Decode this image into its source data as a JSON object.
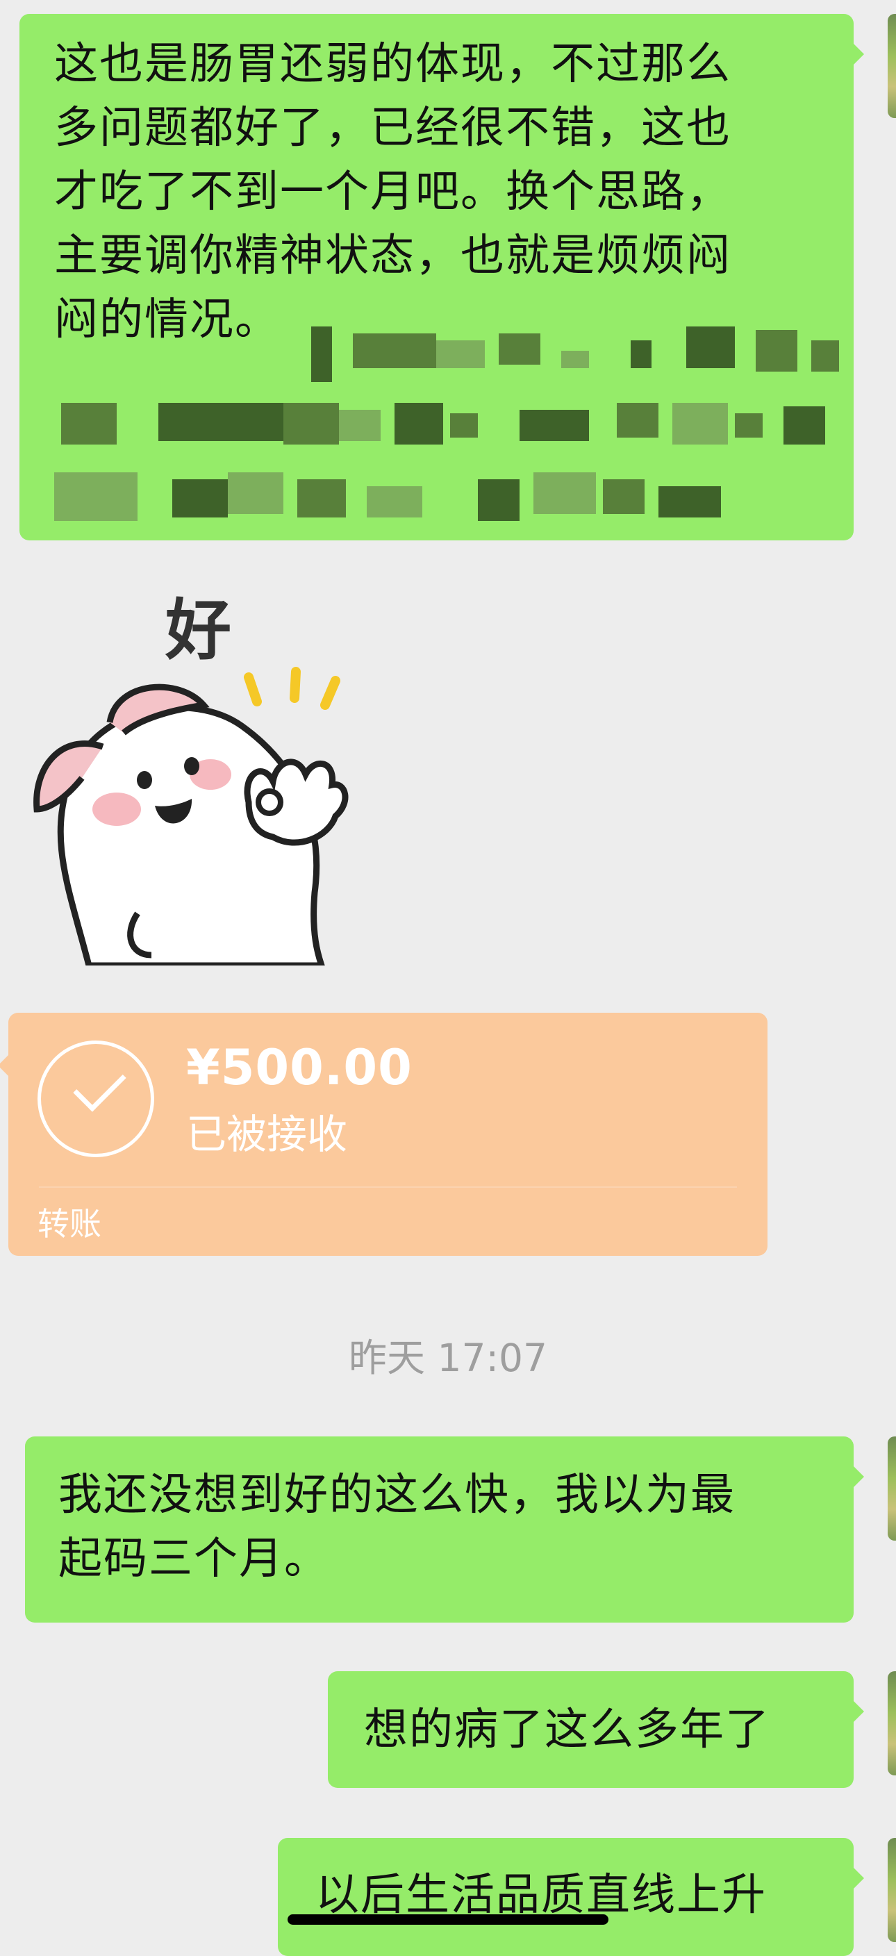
{
  "messages": [
    {
      "id": "msg1",
      "side": "right",
      "text_visible": "这也是肠胃还弱的体现，不过那么\n多问题都好了，已经很不错，这也\n才吃了不到一个月吧。换个思路，\n主要调你精神状态，也就是烦烦闷\n闷的情况。"
    },
    {
      "id": "msg2",
      "side": "right",
      "text": "我还没想到好的这么快，我以为最\n起码三个月。"
    },
    {
      "id": "msg3",
      "side": "right",
      "text": "想的病了这么多年了"
    },
    {
      "id": "msg4",
      "side": "right",
      "text": "以后生活品质直线上升"
    }
  ],
  "sticker": {
    "icon": "ok-hand-bunny-sticker",
    "caption": "好"
  },
  "transfer": {
    "amount": "¥500.00",
    "status": "已被接收",
    "label": "转账",
    "color": "#fbc99c"
  },
  "timestamp": "昨天 17:07",
  "colors": {
    "background": "#ededed",
    "sent_bubble": "#95ec69"
  }
}
